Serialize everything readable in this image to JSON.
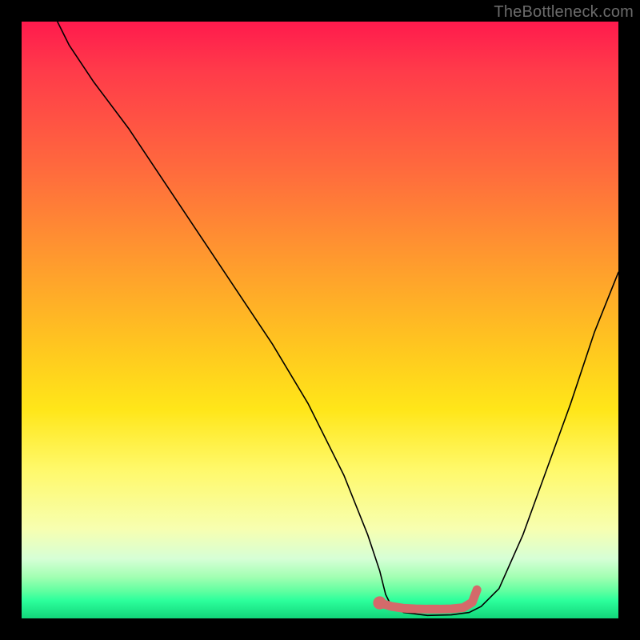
{
  "watermark": "TheBottleneck.com",
  "chart_data": {
    "type": "line",
    "title": "",
    "xlabel": "",
    "ylabel": "",
    "xlim": [
      0,
      100
    ],
    "ylim": [
      0,
      100
    ],
    "grid": false,
    "legend": false,
    "series": [
      {
        "name": "curve",
        "color": "#000000",
        "x": [
          6,
          8,
          12,
          18,
          24,
          30,
          36,
          42,
          48,
          54,
          58,
          60,
          61,
          62,
          64,
          68,
          72,
          75,
          77,
          80,
          84,
          88,
          92,
          96,
          100
        ],
        "y": [
          100,
          96,
          90,
          82,
          73,
          64,
          55,
          46,
          36,
          24,
          14,
          8,
          4,
          2,
          1,
          0.5,
          0.6,
          1,
          2,
          5,
          14,
          25,
          36,
          48,
          58
        ]
      },
      {
        "name": "optimal-band",
        "color": "#d46a6a",
        "x": [
          60,
          62,
          64,
          66,
          68,
          70,
          72,
          74,
          75.5,
          76.3
        ],
        "y": [
          2.6,
          2.0,
          1.7,
          1.6,
          1.55,
          1.55,
          1.6,
          1.8,
          2.7,
          4.8
        ]
      }
    ],
    "markers": [
      {
        "name": "start-dot",
        "x": 60,
        "y": 2.6,
        "color": "#d46a6a",
        "r": 1.1
      }
    ]
  }
}
